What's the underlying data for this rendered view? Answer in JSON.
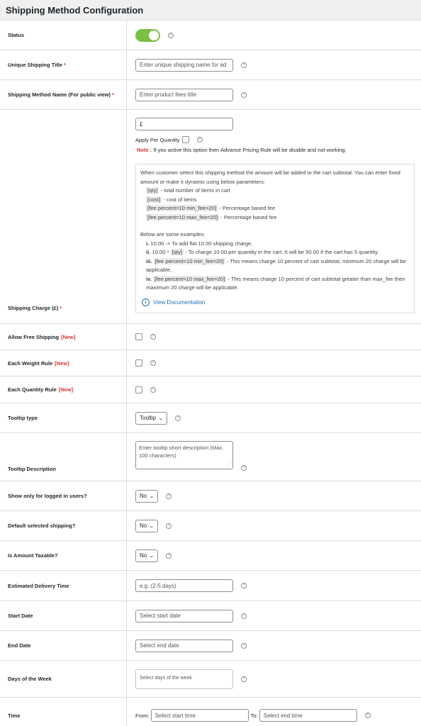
{
  "header": {
    "title": "Shipping Method Configuration"
  },
  "rows": {
    "status": {
      "label": "Status",
      "toggle_on": true
    },
    "unique_title": {
      "label": "Unique Shipping Title",
      "required": "*",
      "placeholder": "Enter unique shipping name for ad"
    },
    "method_name": {
      "label": "Shipping Method Name (For public view)",
      "required": "*",
      "placeholder": "Enter product fees title"
    },
    "charge": {
      "label": "Shipping Charge (£)",
      "required": "*",
      "input_value": "£",
      "apply_per_quantity": "Apply Per Quantity",
      "note_label": "Note :",
      "note_text": "If you active this option then Advance Pricing Rule will be disable and not working.",
      "info": {
        "intro": "When customer select this shipping method the amount will be added to the cart subtotal. You can enter fixed amount or make it dynamic using below parameters:",
        "params": [
          {
            "code": "[qty]",
            "desc": "- total number of items in cart"
          },
          {
            "code": "[cost]",
            "desc": "- cost of items"
          },
          {
            "code": "[fee percent=10 min_fee=20]",
            "desc": "- Percentage based fee"
          },
          {
            "code": "[fee percent=10 max_fee=20]",
            "desc": "- Percentage based fee"
          }
        ],
        "examples_title": "Below are some examples:",
        "examples": [
          {
            "num": "i.",
            "pre": "10.00 -> To add flat 10.00 shipping charge.",
            "code": "",
            "post": ""
          },
          {
            "num": "ii.",
            "pre": "10.00 *",
            "code": "[qty]",
            "post": "- To charge 10.00 per quantity in the cart. It will be 50.00 if the cart has 5 quantity."
          },
          {
            "num": "iii.",
            "pre": "",
            "code": "[fee percent=10 min_fee=20]",
            "post": "- This means charge 10 percent of cart subtotal, minimum 20 charge will be applicable."
          },
          {
            "num": "iv.",
            "pre": "",
            "code": "[fee percent=10 max_fee=20]",
            "post": "- This means charge 10 percent of cart subtotal greater than max_fee then maximum 20 charge will be applicable."
          }
        ],
        "doc_link": "View Documentation"
      }
    },
    "free_shipping": {
      "label": "Allow Free Shipping",
      "badge": "[New]"
    },
    "weight_rule": {
      "label": "Each Weight Rule",
      "badge": "[New]"
    },
    "quantity_rule": {
      "label": "Each Quantity Rule",
      "badge": "[New]"
    },
    "tooltip_type": {
      "label": "Tooltip type",
      "value": "Tooltip"
    },
    "tooltip_desc": {
      "label": "Tooltip Description",
      "placeholder": "Enter tooltip short description (Max. 100 characters)"
    },
    "logged_in": {
      "label": "Show only for logged in users?",
      "value": "No"
    },
    "default_selected": {
      "label": "Default selected shipping?",
      "value": "No"
    },
    "taxable": {
      "label": "Is Amount Taxable?",
      "value": "No"
    },
    "delivery_time": {
      "label": "Estimated Delivery Time",
      "placeholder": "e.g. (2-5 days)"
    },
    "start_date": {
      "label": "Start Date",
      "placeholder": "Select start date"
    },
    "end_date": {
      "label": "End Date",
      "placeholder": "Select end date"
    },
    "days_of_week": {
      "label": "Days of the Week",
      "placeholder": "Select days of the week"
    },
    "time": {
      "label": "Time",
      "from_label": "From:",
      "from_placeholder": "Select start time",
      "to_label": "To:",
      "to_placeholder": "Select end time"
    }
  },
  "help_glyph": "?",
  "colors": {
    "toggle_on": "#7ac043",
    "required": "#d63638",
    "link": "#2271b1"
  }
}
